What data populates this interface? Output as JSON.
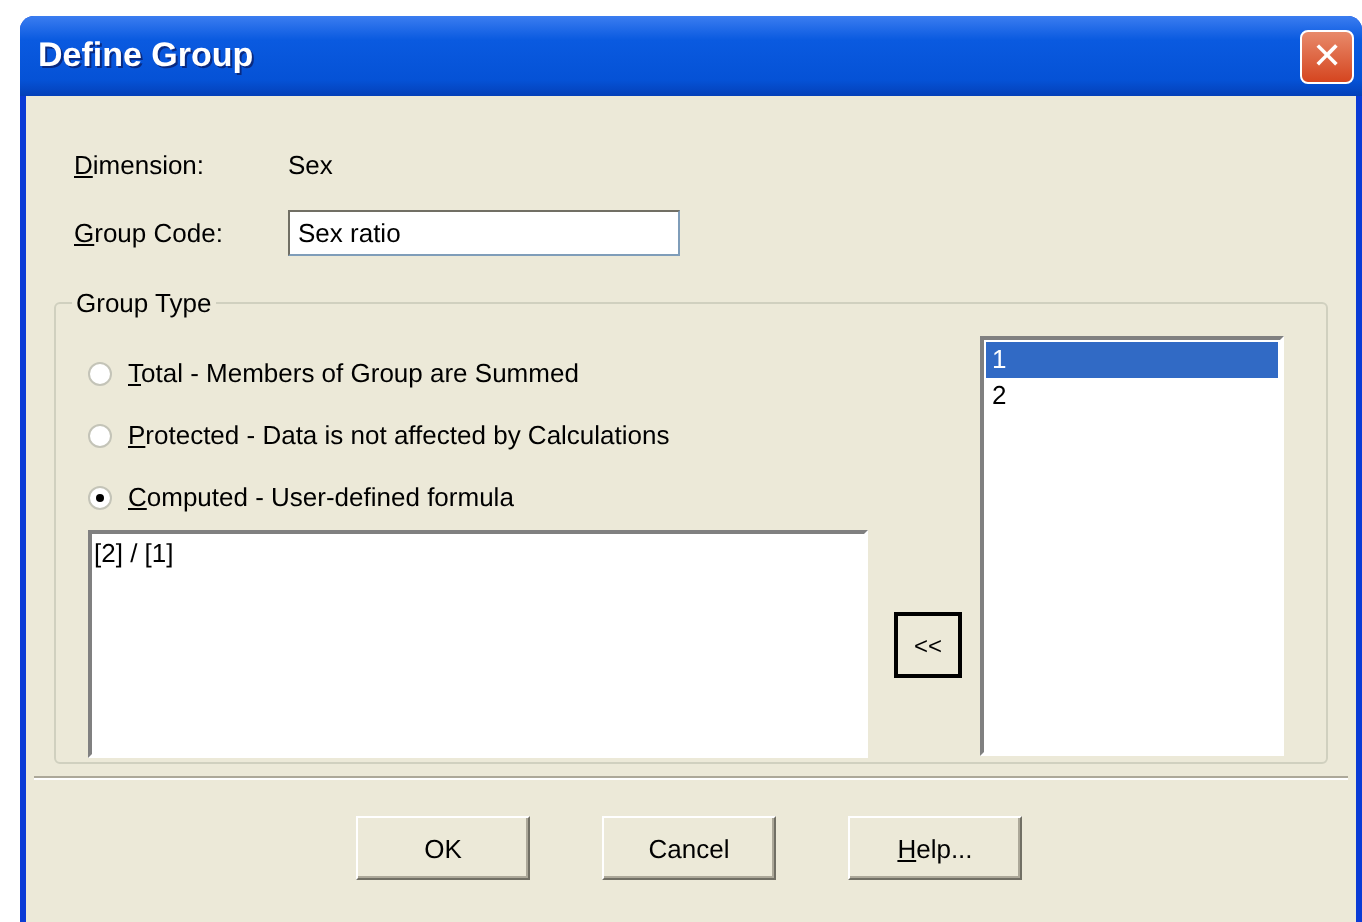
{
  "window": {
    "title": "Define Group",
    "close_glyph": "✕"
  },
  "dimension": {
    "label": "Dimension:",
    "access_key_underlined": true,
    "value": "Sex"
  },
  "group_code": {
    "label": "Group Code:",
    "access_key_underlined": true,
    "value": "Sex ratio"
  },
  "group_type": {
    "legend": "Group Type",
    "options": [
      {
        "label": "Total - Members of Group are Summed",
        "access_key_underlined": true,
        "selected": false
      },
      {
        "label": "Protected - Data is not affected by Calculations",
        "access_key_underlined": true,
        "selected": false
      },
      {
        "label": "Computed - User-defined formula",
        "access_key_underlined": true,
        "selected": true
      }
    ],
    "formula": "[2] / [1]",
    "insert_button": "<<",
    "members": [
      {
        "label": "1",
        "selected": true
      },
      {
        "label": "2",
        "selected": false
      }
    ]
  },
  "buttons": [
    {
      "label": "OK",
      "access_key_underlined": false
    },
    {
      "label": "Cancel",
      "access_key_underlined": false
    },
    {
      "label": "Help...",
      "access_key_underlined": true
    }
  ]
}
